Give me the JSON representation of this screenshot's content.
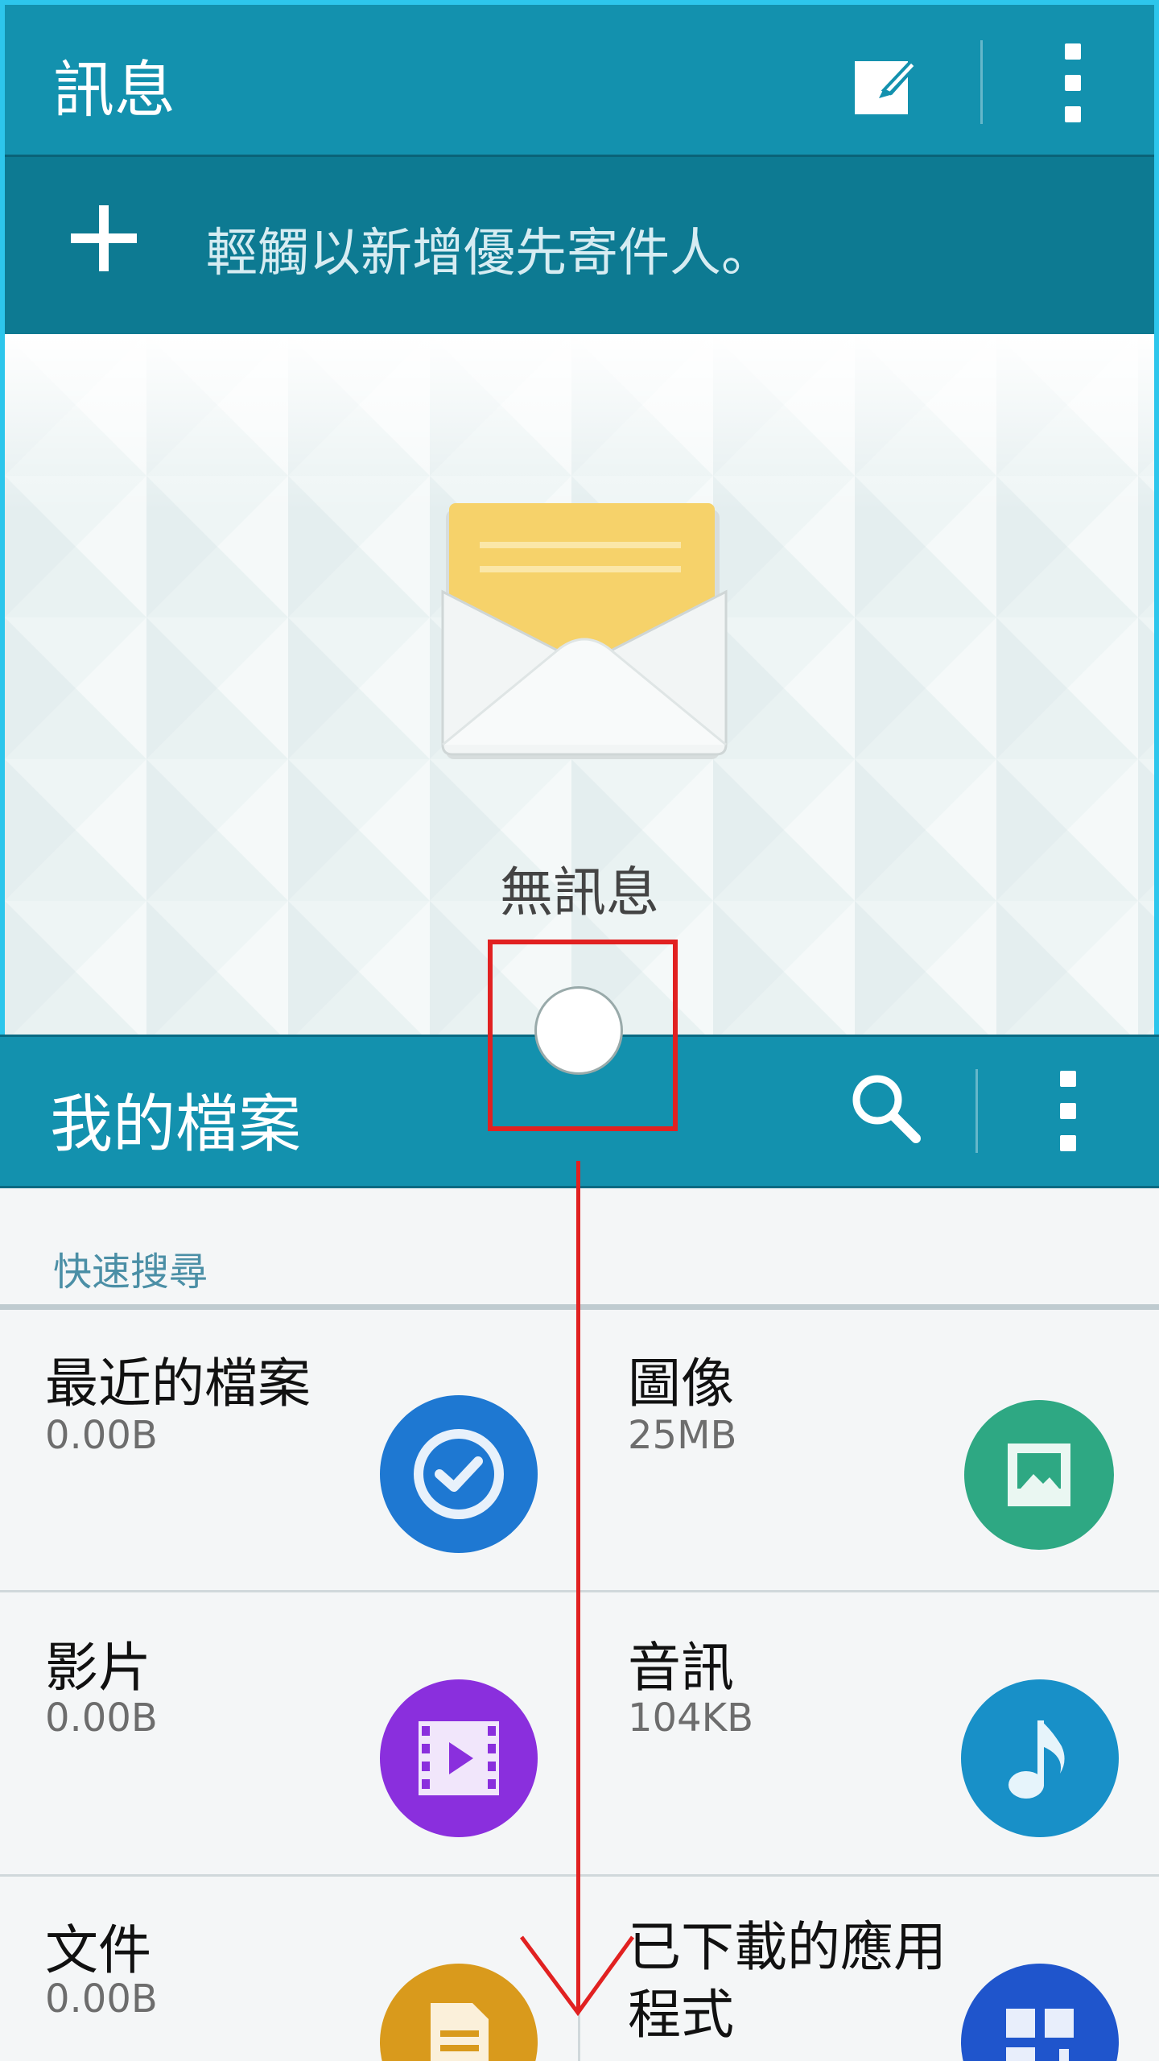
{
  "messages": {
    "title": "訊息",
    "compose_icon": "compose-icon",
    "menu_icon": "more-vert-icon",
    "priority_sender": "輕觸以新增優先寄件人。",
    "empty_text": "無訊息"
  },
  "my_files": {
    "title": "我的檔案",
    "search_icon": "search-icon",
    "menu_icon": "more-vert-icon",
    "section_label": "快速搜尋",
    "categories": [
      {
        "name": "最近的檔案",
        "size": "0.00B",
        "icon": "check-clock-icon",
        "color": "#1e78d2"
      },
      {
        "name": "圖像",
        "size": "25MB",
        "icon": "image-icon",
        "color": "#2ea883"
      },
      {
        "name": "影片",
        "size": "0.00B",
        "icon": "video-icon",
        "color": "#8a2fdd"
      },
      {
        "name": "音訊",
        "size": "104KB",
        "icon": "music-note-icon",
        "color": "#1890c8"
      },
      {
        "name": "文件",
        "size": "0.00B",
        "icon": "document-icon",
        "color": "#d99a1c"
      },
      {
        "name": "已下載的應用\n程式",
        "size": "",
        "icon": "download-apps-icon",
        "color": "#1f55cc"
      }
    ]
  },
  "annotation_color": "#e12121"
}
